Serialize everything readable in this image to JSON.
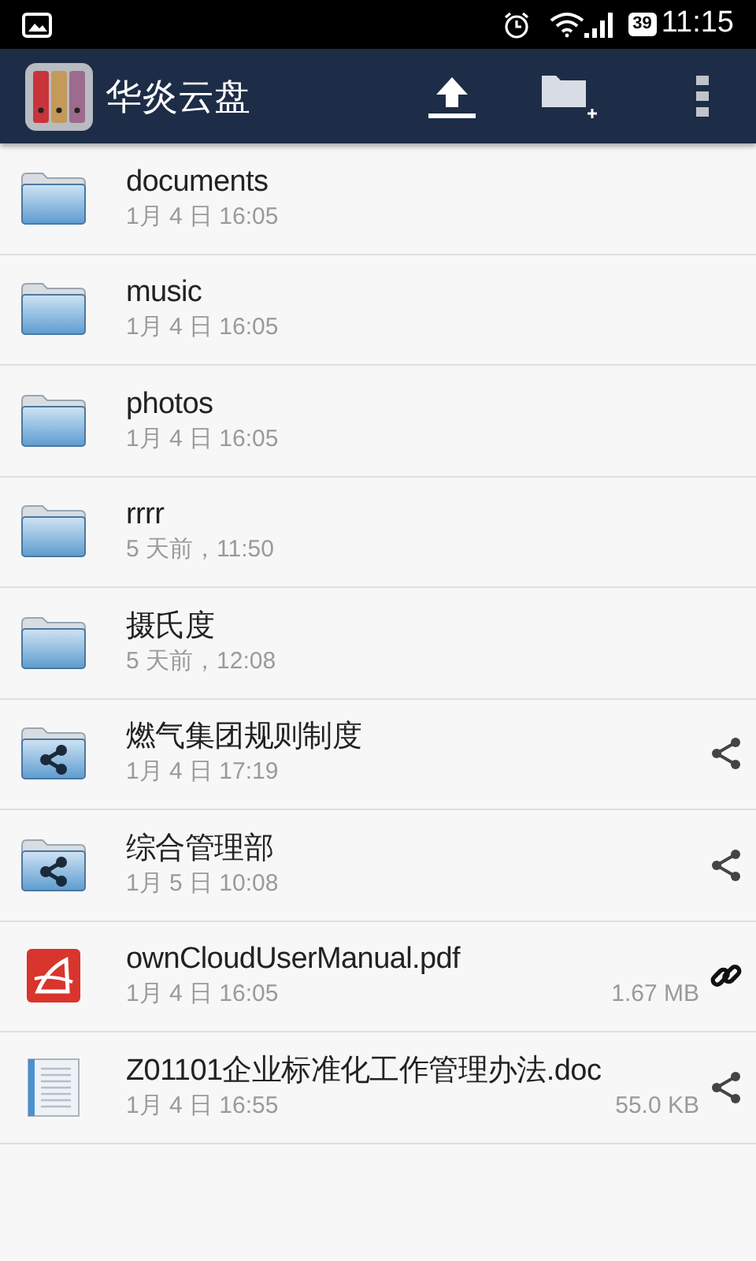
{
  "status_bar": {
    "battery": "39",
    "time": "11:15"
  },
  "app_bar": {
    "title": "华炎云盘"
  },
  "files": [
    {
      "kind": "folder",
      "name": "documents",
      "date": "1月 4 日 16:05"
    },
    {
      "kind": "folder",
      "name": "music",
      "date": "1月 4 日 16:05"
    },
    {
      "kind": "folder",
      "name": "photos",
      "date": "1月 4 日 16:05"
    },
    {
      "kind": "folder",
      "name": "rrrr",
      "date": "5 天前，11:50"
    },
    {
      "kind": "folder",
      "name": "摄氏度",
      "date": "5 天前，12:08"
    },
    {
      "kind": "shared_folder",
      "name": "燃气集团规则制度",
      "date": "1月 4 日 17:19",
      "action": {
        "kind": "share"
      }
    },
    {
      "kind": "shared_folder",
      "name": "综合管理部",
      "date": "1月 5 日 10:08",
      "action": {
        "kind": "share"
      }
    },
    {
      "kind": "pdf",
      "name": "ownCloudUserManual.pdf",
      "date": "1月 4 日 16:05",
      "size": "1.67 MB",
      "action": {
        "kind": "link"
      }
    },
    {
      "kind": "doc",
      "name": "Z01101企业标准化工作管理办法.doc",
      "date": "1月 4 日 16:55",
      "size": "55.0 KB",
      "action": {
        "kind": "share"
      }
    }
  ]
}
